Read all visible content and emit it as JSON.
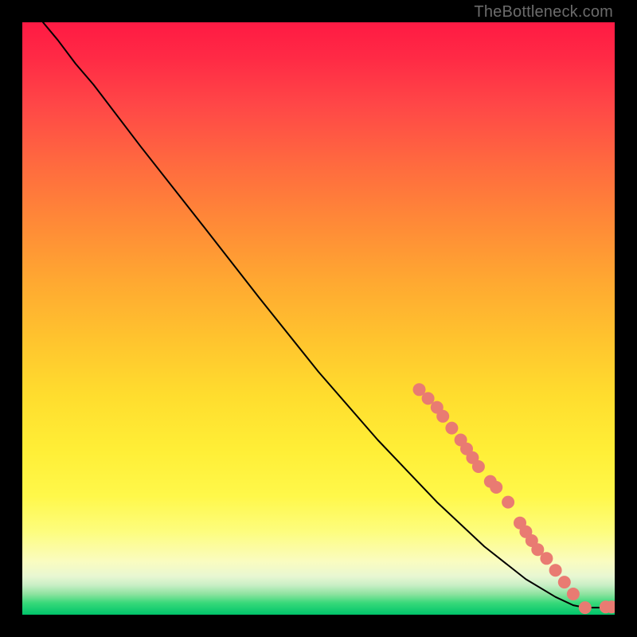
{
  "attribution": "TheBottleneck.com",
  "colors": {
    "background": "#000000",
    "dot": "#e97b72",
    "curve": "#000000"
  },
  "chart_data": {
    "type": "line",
    "title": "",
    "xlabel": "",
    "ylabel": "",
    "xlim": [
      0,
      100
    ],
    "ylim": [
      0,
      100
    ],
    "grid": false,
    "legend": false,
    "series": [
      {
        "name": "curve",
        "kind": "line",
        "points": [
          {
            "x": 3.5,
            "y": 100.0
          },
          {
            "x": 6.0,
            "y": 97.0
          },
          {
            "x": 9.0,
            "y": 93.0
          },
          {
            "x": 12.0,
            "y": 89.5
          },
          {
            "x": 20.0,
            "y": 79.0
          },
          {
            "x": 30.0,
            "y": 66.3
          },
          {
            "x": 40.0,
            "y": 53.5
          },
          {
            "x": 50.0,
            "y": 41.0
          },
          {
            "x": 60.0,
            "y": 29.5
          },
          {
            "x": 70.0,
            "y": 19.0
          },
          {
            "x": 78.0,
            "y": 11.5
          },
          {
            "x": 85.0,
            "y": 6.0
          },
          {
            "x": 90.0,
            "y": 3.0
          },
          {
            "x": 93.0,
            "y": 1.6
          },
          {
            "x": 95.0,
            "y": 1.2
          },
          {
            "x": 97.0,
            "y": 1.2
          },
          {
            "x": 99.0,
            "y": 1.2
          }
        ]
      },
      {
        "name": "dots",
        "kind": "scatter",
        "points": [
          {
            "x": 67.0,
            "y": 38.0
          },
          {
            "x": 68.5,
            "y": 36.5
          },
          {
            "x": 70.0,
            "y": 35.0
          },
          {
            "x": 71.0,
            "y": 33.5
          },
          {
            "x": 72.5,
            "y": 31.5
          },
          {
            "x": 74.0,
            "y": 29.5
          },
          {
            "x": 75.0,
            "y": 28.0
          },
          {
            "x": 76.0,
            "y": 26.5
          },
          {
            "x": 77.0,
            "y": 25.0
          },
          {
            "x": 79.0,
            "y": 22.5
          },
          {
            "x": 80.0,
            "y": 21.5
          },
          {
            "x": 82.0,
            "y": 19.0
          },
          {
            "x": 84.0,
            "y": 15.5
          },
          {
            "x": 85.0,
            "y": 14.0
          },
          {
            "x": 86.0,
            "y": 12.5
          },
          {
            "x": 87.0,
            "y": 11.0
          },
          {
            "x": 88.5,
            "y": 9.5
          },
          {
            "x": 90.0,
            "y": 7.5
          },
          {
            "x": 91.5,
            "y": 5.5
          },
          {
            "x": 93.0,
            "y": 3.5
          },
          {
            "x": 95.0,
            "y": 1.2
          },
          {
            "x": 98.5,
            "y": 1.3
          },
          {
            "x": 99.5,
            "y": 1.3
          }
        ]
      }
    ]
  }
}
